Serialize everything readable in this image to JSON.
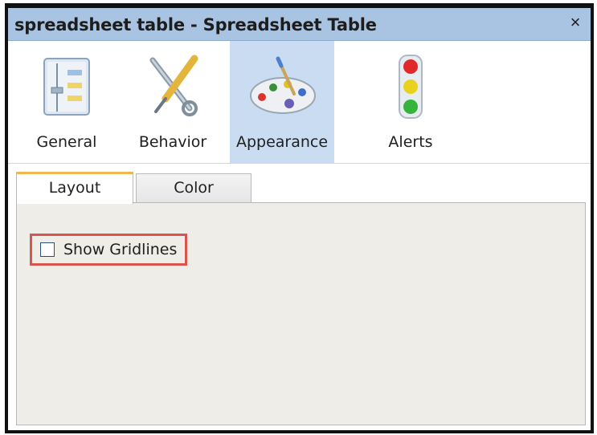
{
  "window": {
    "title": "spreadsheet table - Spreadsheet Table",
    "close_glyph": "×"
  },
  "toolbar": {
    "items": [
      {
        "label": "General",
        "icon": "general-settings-icon",
        "active": false
      },
      {
        "label": "Behavior",
        "icon": "tools-icon",
        "active": false
      },
      {
        "label": "Appearance",
        "icon": "palette-icon",
        "active": true
      },
      {
        "label": "Alerts",
        "icon": "traffic-light-icon",
        "active": false
      }
    ]
  },
  "tabs": [
    {
      "label": "Layout",
      "active": true
    },
    {
      "label": "Color",
      "active": false
    }
  ],
  "layout_panel": {
    "show_gridlines": {
      "label": "Show Gridlines",
      "checked": false
    }
  },
  "colors": {
    "titlebar": "#a9c4e2",
    "active_tool": "#c9dcf1",
    "tab_accent": "#f1b64d",
    "highlight": "#d9534f",
    "panel_bg": "#efede8"
  }
}
